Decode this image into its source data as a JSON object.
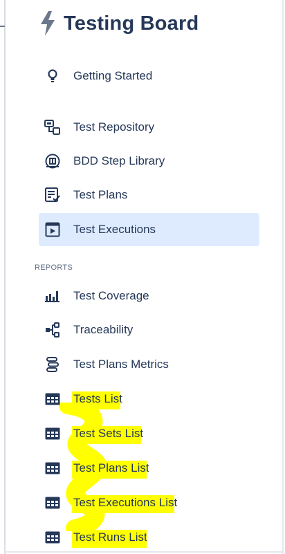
{
  "board": {
    "title": "Testing Board"
  },
  "nav": {
    "getting_started": "Getting Started",
    "test_repository": "Test Repository",
    "bdd_step_library": "BDD Step Library",
    "test_plans": "Test Plans",
    "test_executions": "Test Executions"
  },
  "reports": {
    "heading": "REPORTS",
    "test_coverage": "Test Coverage",
    "traceability": "Traceability",
    "test_plans_metrics": "Test Plans Metrics",
    "tests_list": "Tests List",
    "test_sets_list": "Test Sets List",
    "test_plans_list": "Test Plans List",
    "test_executions_list": "Test Executions List",
    "test_runs_list": "Test Runs List"
  },
  "colors": {
    "active_bg": "#deebff",
    "highlight": "#ffff00",
    "text": "#253858",
    "icon": "#253858"
  },
  "icons": {
    "logo": "lightning-bolt-icon",
    "getting_started": "lightbulb-icon",
    "test_repository": "repository-icon",
    "bdd_step_library": "step-library-icon",
    "test_plans": "checklist-icon",
    "test_executions": "play-square-icon",
    "test_coverage": "bar-chart-icon",
    "traceability": "hierarchy-icon",
    "test_plans_metrics": "metrics-icon",
    "list": "table-grid-icon"
  }
}
